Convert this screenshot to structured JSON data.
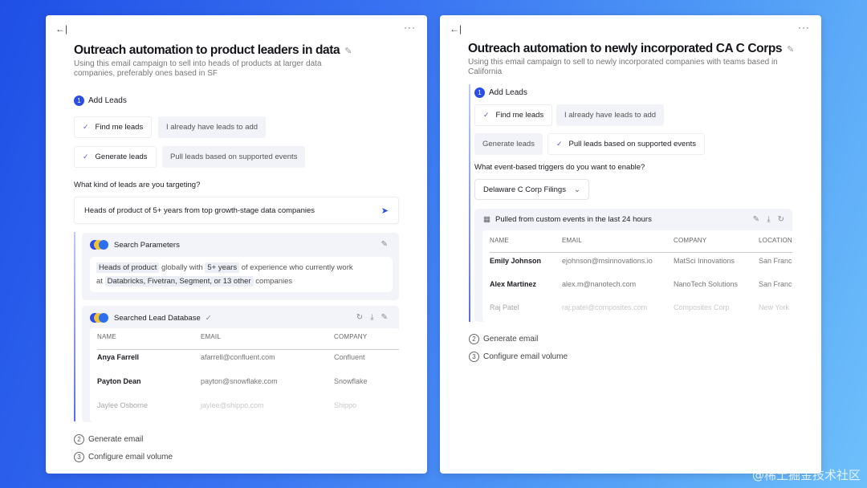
{
  "left": {
    "title": "Outreach automation to product leaders in data",
    "subtitle": "Using this email campaign to sell into heads of products at larger data companies, preferably ones based in SF",
    "step1": {
      "num": "1",
      "label": "Add Leads"
    },
    "options": [
      "Find me leads",
      "I already have leads to add",
      "Generate leads",
      "Pull leads based on supported events"
    ],
    "question": "What kind of leads are you targeting?",
    "input_value": "Heads of product of 5+ years from top growth-stage data companies",
    "params": {
      "title": "Search Parameters",
      "t1": "Heads of product",
      "s1": "globally with",
      "t2": "5+ years",
      "s2": "of experience who currently work",
      "s3": "at",
      "t3": "Databricks, Fivetran, Segment, or 13 other",
      "s4": "companies"
    },
    "db": {
      "title": "Searched Lead Database",
      "headers": [
        "NAME",
        "EMAIL",
        "COMPANY"
      ],
      "rows": [
        [
          "Anya Farrell",
          "afarrell@confluent.com",
          "Confluent"
        ],
        [
          "Payton Dean",
          "payton@snowflake.com",
          "Snowflake"
        ],
        [
          "Jaylee Osborne",
          "jaylee@shippo.com",
          "Shippo"
        ]
      ]
    },
    "step2": {
      "num": "2",
      "label": "Generate email"
    },
    "step3": {
      "num": "3",
      "label": "Configure email volume"
    }
  },
  "right": {
    "title": "Outreach automation to newly incorporated CA C Corps",
    "subtitle": "Using this email campaign to sell to newly incorporated companies with teams based in California",
    "step1": {
      "num": "1",
      "label": "Add Leads"
    },
    "options": [
      "Find me leads",
      "I already have leads to add",
      "Generate leads",
      "Pull leads based on supported events"
    ],
    "question": "What event-based triggers do you want to enable?",
    "select_value": "Delaware C Corp Filings",
    "events": {
      "title": "Pulled from custom events in the last 24 hours",
      "headers": [
        "NAME",
        "EMAIL",
        "COMPANY",
        "LOCATION"
      ],
      "rows": [
        [
          "Emily Johnson",
          "ejohnson@msinnovations.io",
          "MatSci Innovations",
          "San Franc"
        ],
        [
          "Alex Martinez",
          "alex.m@nanotech.com",
          "NanoTech Solutions",
          "San Franc"
        ],
        [
          "Raj Patel",
          "raj.patel@composites.com",
          "Composites Corp",
          "New York"
        ]
      ]
    },
    "step2": {
      "num": "2",
      "label": "Generate email"
    },
    "step3": {
      "num": "3",
      "label": "Configure email volume"
    }
  },
  "icons": {
    "back": "←|",
    "more": "···",
    "pencil": "✎",
    "check": "✓",
    "send": "➤",
    "refresh": "↻",
    "download": "⤓",
    "chevron": "⌄",
    "table": "▦"
  },
  "colors": {
    "accent": "#2b4ee6",
    "check": "#5b5bd6"
  },
  "watermark": "@稀土掘金技术社区"
}
